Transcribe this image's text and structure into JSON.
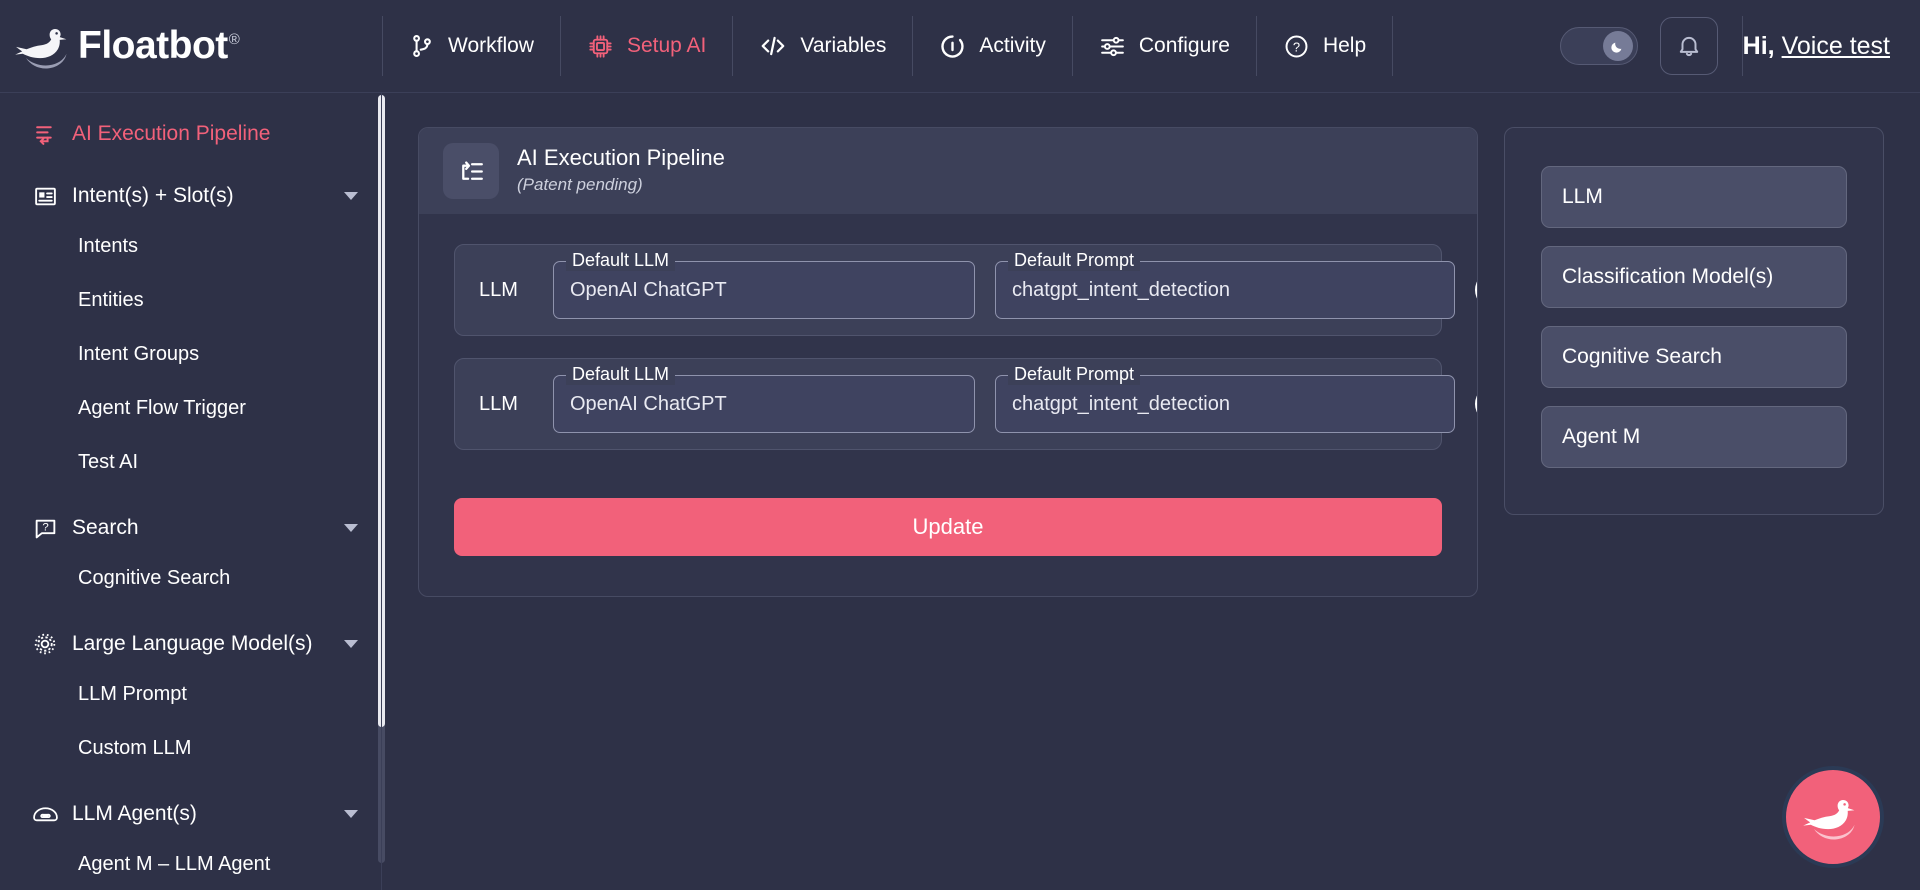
{
  "brand": {
    "name": "Floatbot",
    "registered_mark": "®",
    "logo_icon": "swan-logo-icon"
  },
  "topnav": {
    "items": [
      {
        "label": "Workflow",
        "icon": "git-branch-icon",
        "active": false
      },
      {
        "label": "Setup AI",
        "icon": "chip-ai-icon",
        "active": true
      },
      {
        "label": "Variables",
        "icon": "code-brackets-icon",
        "active": false
      },
      {
        "label": "Activity",
        "icon": "activity-circle-icon",
        "active": false
      },
      {
        "label": "Configure",
        "icon": "sliders-icon",
        "active": false
      },
      {
        "label": "Help",
        "icon": "question-circle-icon",
        "active": false
      }
    ],
    "theme_toggle": {
      "icon": "moon-icon",
      "state": "dark"
    },
    "notifications_icon": "bell-icon",
    "greeting_prefix": "Hi,",
    "user_name": "Voice test"
  },
  "sidebar": {
    "groups": [
      {
        "label": "AI Execution Pipeline",
        "icon": "pipeline-icon",
        "active": true,
        "has_chevron": false,
        "items": []
      },
      {
        "label": "Intent(s) + Slot(s)",
        "icon": "card-list-icon",
        "active": false,
        "has_chevron": true,
        "items": [
          "Intents",
          "Entities",
          "Intent Groups",
          "Agent Flow Trigger",
          "Test AI"
        ]
      },
      {
        "label": "Search",
        "icon": "question-bubble-icon",
        "active": false,
        "has_chevron": true,
        "items": [
          "Cognitive Search"
        ]
      },
      {
        "label": "Large Language Model(s)",
        "icon": "gear-icon",
        "active": false,
        "has_chevron": true,
        "items": [
          "LLM Prompt",
          "Custom LLM"
        ]
      },
      {
        "label": "LLM Agent(s)",
        "icon": "robot-icon",
        "active": false,
        "has_chevron": true,
        "items": [
          "Agent M – LLM Agent"
        ]
      }
    ]
  },
  "pipeline_card": {
    "icon": "pipeline-icon",
    "title": "AI Execution Pipeline",
    "subtitle": "(Patent pending)",
    "rows": [
      {
        "tag": "LLM",
        "llm_label": "Default LLM",
        "llm_value": "OpenAI ChatGPT",
        "prompt_label": "Default Prompt",
        "prompt_value": "chatgpt_intent_detection",
        "info_icon": "info-icon"
      },
      {
        "tag": "LLM",
        "llm_label": "Default LLM",
        "llm_value": "OpenAI ChatGPT",
        "prompt_label": "Default Prompt",
        "prompt_value": "chatgpt_intent_detection",
        "info_icon": "info-icon"
      }
    ],
    "update_label": "Update"
  },
  "component_panel": {
    "chips": [
      "LLM",
      "Classification Model(s)",
      "Cognitive Search",
      "Agent M"
    ]
  },
  "chat_fab": {
    "icon": "swan-logo-icon"
  },
  "colors": {
    "background": "#2e3147",
    "panel": "#31344b",
    "panel_light": "#3c4058",
    "chip": "#4a4e68",
    "accent": "#f2617a",
    "text": "#ffffff",
    "border": "#474b63"
  }
}
